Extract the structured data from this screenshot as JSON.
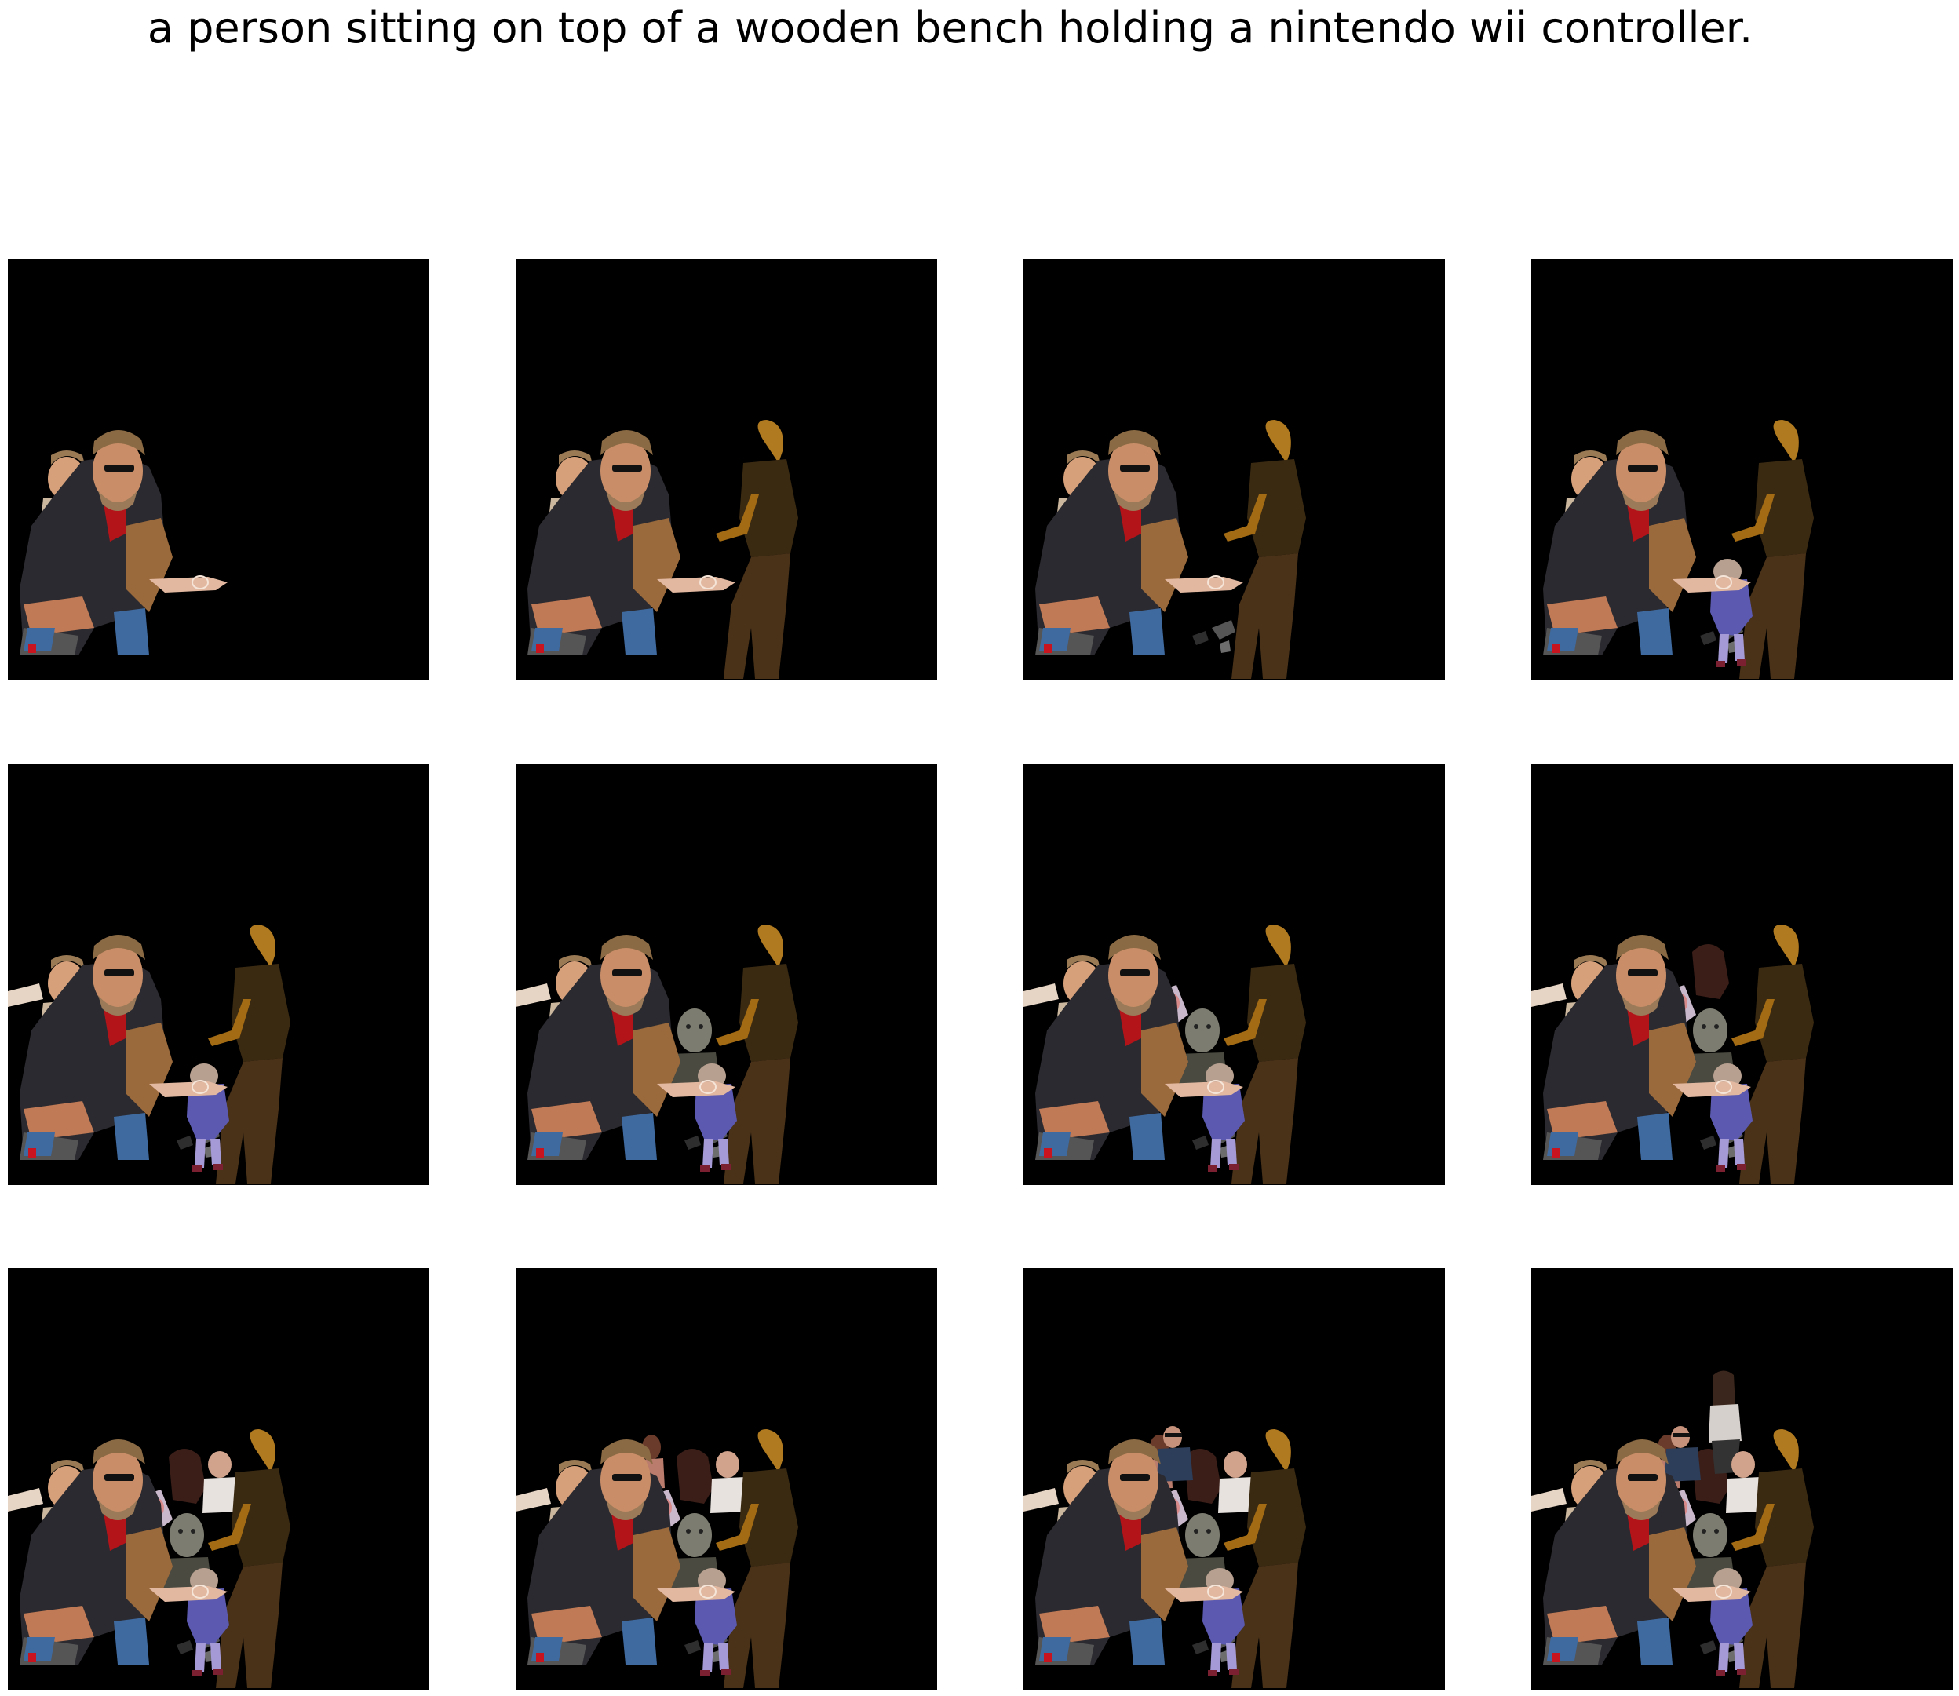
{
  "caption": "a person sitting on top of a wooden bench holding a nintendo wii controller.",
  "frames": [
    {
      "layers": [
        "man",
        "child",
        "hand"
      ]
    },
    {
      "layers": [
        "man",
        "child",
        "hand",
        "standing"
      ]
    },
    {
      "layers": [
        "man",
        "child",
        "hand",
        "standing",
        "debris"
      ]
    },
    {
      "layers": [
        "man",
        "child",
        "hand",
        "standing",
        "debris",
        "toddler"
      ]
    },
    {
      "layers": [
        "man",
        "child",
        "hand",
        "standing",
        "debris",
        "toddler",
        "armleft"
      ]
    },
    {
      "layers": [
        "man",
        "child",
        "hand",
        "standing",
        "debris",
        "toddler",
        "armleft",
        "baby"
      ]
    },
    {
      "layers": [
        "man",
        "child",
        "hand",
        "standing",
        "debris",
        "toddler",
        "armleft",
        "baby",
        "blur"
      ]
    },
    {
      "layers": [
        "man",
        "child",
        "hand",
        "standing",
        "debris",
        "toddler",
        "armleft",
        "baby",
        "blur",
        "darkfig"
      ]
    },
    {
      "layers": [
        "man",
        "child",
        "hand",
        "standing",
        "debris",
        "toddler",
        "armleft",
        "baby",
        "blur",
        "darkfig",
        "oldman"
      ]
    },
    {
      "layers": [
        "man",
        "child",
        "hand",
        "standing",
        "debris",
        "toddler",
        "armleft",
        "baby",
        "blur",
        "darkfig",
        "oldman",
        "woman"
      ]
    },
    {
      "layers": [
        "man",
        "child",
        "hand",
        "standing",
        "debris",
        "toddler",
        "armleft",
        "baby",
        "blur",
        "darkfig",
        "oldman",
        "woman",
        "glasses"
      ]
    },
    {
      "layers": [
        "man",
        "child",
        "hand",
        "standing",
        "debris",
        "toddler",
        "armleft",
        "baby",
        "blur",
        "darkfig",
        "oldman",
        "woman",
        "glasses",
        "lady"
      ]
    }
  ]
}
